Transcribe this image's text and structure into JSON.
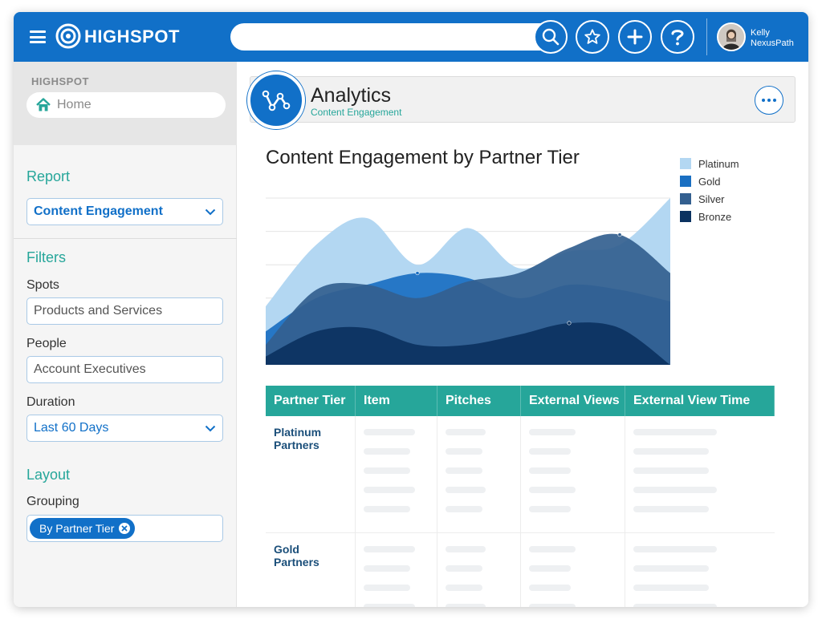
{
  "topbar": {
    "brand": "HIGHSPOT",
    "search": {
      "value": "",
      "placeholder": ""
    },
    "user": {
      "first": "Kelly",
      "last": "NexusPath"
    },
    "icons": [
      "menu-icon",
      "search-icon",
      "star-icon",
      "plus-icon",
      "help-icon"
    ]
  },
  "sidebar": {
    "brand": "HIGHSPOT",
    "home_label": "Home",
    "report": {
      "title": "Report",
      "selected": "Content Engagement"
    },
    "filters": {
      "title": "Filters",
      "spots_label": "Spots",
      "spots_value": "Products and Services",
      "people_label": "People",
      "people_value": "Account Executives",
      "duration_label": "Duration",
      "duration_value": "Last 60 Days"
    },
    "layout": {
      "title": "Layout",
      "grouping_label": "Grouping",
      "grouping_chip": "By Partner Tier"
    }
  },
  "header": {
    "title": "Analytics",
    "subtitle": "Content Engagement"
  },
  "chart_data": {
    "type": "area",
    "title": "Content Engagement by Partner Tier",
    "xlabel": "",
    "ylabel": "",
    "ylim": [
      0,
      100
    ],
    "legend_position": "top-right",
    "grid": true,
    "x": [
      0,
      1,
      2,
      3,
      4,
      5,
      6,
      7,
      8
    ],
    "series": [
      {
        "name": "Platinum",
        "color": "#b3d7f2",
        "values": [
          35,
          72,
          88,
          60,
          82,
          58,
          68,
          72,
          100
        ]
      },
      {
        "name": "Gold",
        "color": "#1a6fc2",
        "values": [
          20,
          40,
          48,
          55,
          52,
          40,
          48,
          45,
          38
        ]
      },
      {
        "name": "Silver",
        "color": "#335f8f",
        "values": [
          12,
          45,
          48,
          40,
          50,
          55,
          70,
          78,
          55
        ]
      },
      {
        "name": "Bronze",
        "color": "#0b3260",
        "values": [
          5,
          20,
          22,
          12,
          12,
          18,
          25,
          22,
          0
        ]
      }
    ]
  },
  "table": {
    "headers": [
      "Partner Tier",
      "Item",
      "Pitches",
      "External Views",
      "External View Time"
    ],
    "rows": [
      {
        "tier": "Platinum Partners"
      },
      {
        "tier": "Gold Partners"
      }
    ]
  }
}
